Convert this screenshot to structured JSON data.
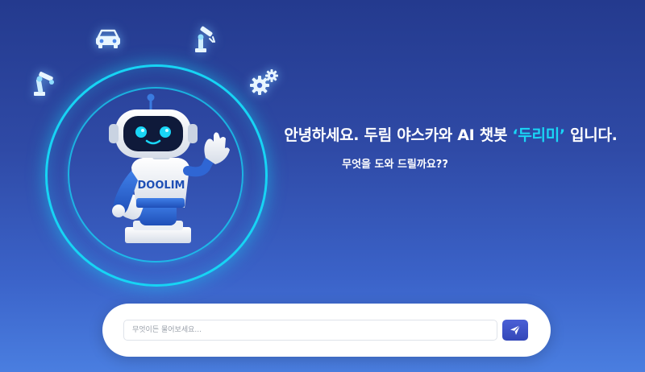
{
  "hero": {
    "greeting_prefix": "안녕하세요. 두림 야스카와 AI 챗봇 ",
    "bot_name": "‘두리미’",
    "greeting_suffix": " 입니다.",
    "subtitle": "무엇을 도와 드릴까요??"
  },
  "mascot": {
    "chest_text": "DOOLIM"
  },
  "decor_icons": [
    "robot-arm-left-icon",
    "car-icon",
    "robot-arm-icon",
    "gears-icon"
  ],
  "chat": {
    "placeholder": "무엇이든 물어보세요...",
    "value": "",
    "send_icon": "paper-plane-icon"
  },
  "colors": {
    "accent": "#19d6f6",
    "send_button": "#3a4ec4",
    "background_top": "#243a8e",
    "background_bottom": "#4a7ee0"
  }
}
